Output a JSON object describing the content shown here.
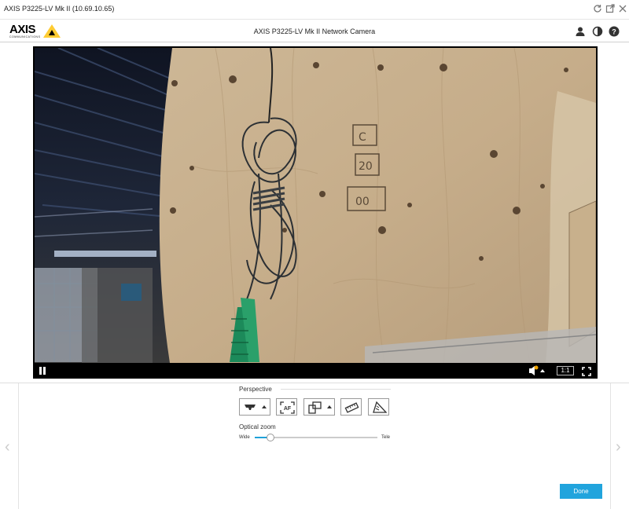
{
  "window": {
    "title": "AXIS P3225-LV Mk II (10.69.10.65)"
  },
  "header": {
    "logo_text": "AXIS",
    "logo_subtext": "COMMUNICATIONS",
    "title": "AXIS P3225-LV Mk II Network Camera"
  },
  "video": {
    "ratio_label": "1:1"
  },
  "perspective": {
    "label": "Perspective",
    "tools": [
      {
        "name": "mount-position",
        "has_dropdown": true
      },
      {
        "name": "autofocus",
        "label": "AF"
      },
      {
        "name": "rotate-view",
        "has_dropdown": true
      },
      {
        "name": "focus-window"
      },
      {
        "name": "level-horizon"
      }
    ]
  },
  "optical_zoom": {
    "label": "Optical zoom",
    "min_label": "Wide",
    "max_label": "Tele",
    "value_fraction": 0.13
  },
  "actions": {
    "done_label": "Done"
  },
  "colors": {
    "accent": "#21a4dd",
    "logo_yellow": "#ffcc33"
  }
}
